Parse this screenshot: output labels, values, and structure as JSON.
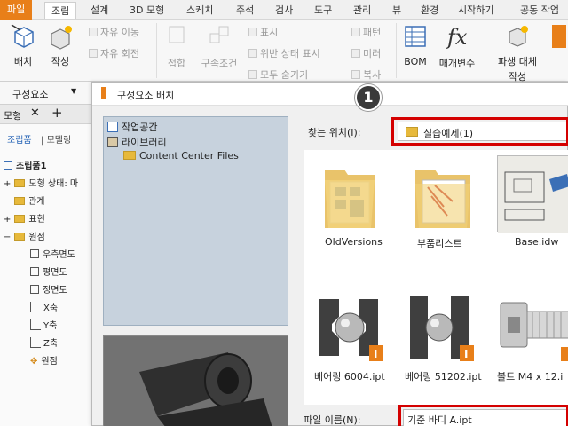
{
  "ribbon_tabs": [
    "파일",
    "조립",
    "설계",
    "3D 모형",
    "스케치",
    "주석",
    "검사",
    "도구",
    "관리",
    "뷰",
    "환경",
    "시작하기",
    "공동 작업"
  ],
  "ribbon": {
    "place": "배치",
    "create": "작성",
    "free_move": "자유 이동",
    "free_rotate": "자유 회전",
    "join": "접합",
    "constraint": "구속조건",
    "show": "표시",
    "violation_status": "위반 상태 표시",
    "hide_all": "모두 숨기기",
    "pattern": "패턴",
    "mirror": "미러",
    "copy": "복사",
    "bom": "BOM",
    "parameters": "매개변수",
    "derive_substitute": "파생 대체",
    "create2": "작성",
    "group_label": "구성요소"
  },
  "browser": {
    "tab_label": "모형",
    "tab_add": "+",
    "subtab_assembly": "조립품",
    "subtab_modeling": "모델링",
    "root": "조립품1",
    "items": [
      "모형 상태: 마",
      "관계",
      "표현",
      "원점",
      "우측면도",
      "평면도",
      "정면도",
      "X축",
      "Y축",
      "Z축",
      "원점"
    ]
  },
  "dialog": {
    "title": "구성요소 배치",
    "badge": "1",
    "places": [
      "작업공간",
      "라이브러리",
      "Content Center Files"
    ],
    "look_in_label": "찾는 위치(I):",
    "look_in_value": "실습예제(1)",
    "files": [
      "OldVersions",
      "부품리스트",
      "Base.idw",
      "베어링 6004.ipt",
      "베어링 51202.ipt",
      "볼트 M4 x 12.i"
    ],
    "filename_label": "파일 이름(N):",
    "filename_value": "기준 바디 A.ipt"
  },
  "colors": {
    "file_tab": "#e87f19",
    "highlight": "#d40000",
    "folder": "#e7b93b"
  }
}
